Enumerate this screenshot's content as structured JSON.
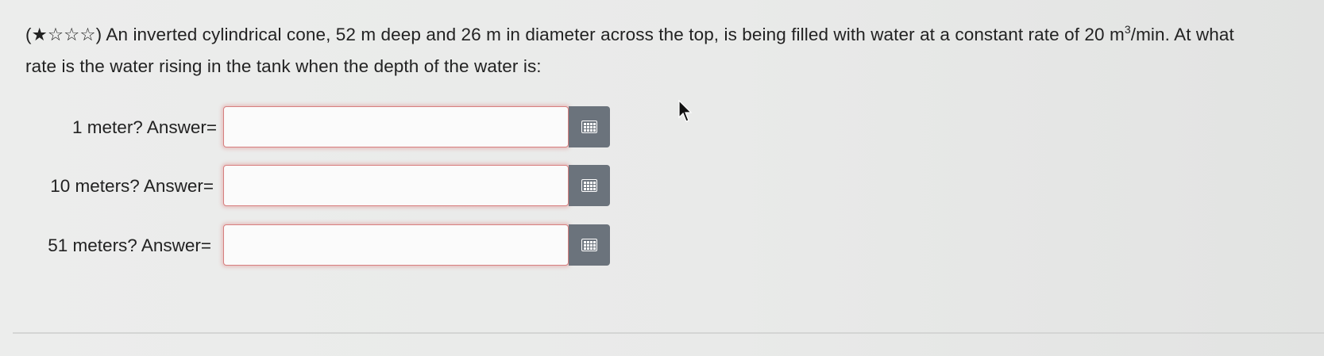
{
  "question": {
    "stars": "(★☆☆☆)",
    "text_before_unit": " An inverted cylindrical cone, 52 m deep and 26 m in diameter across the top, is being filled with water at a constant rate of 20 m",
    "unit_exponent": "3",
    "text_after_unit": "/min. At what rate is the water rising in the tank when the depth of the water is:"
  },
  "answers": [
    {
      "label": "1 meter? Answer=",
      "value": ""
    },
    {
      "label": "10 meters? Answer=",
      "value": ""
    },
    {
      "label": "51 meters? Answer=",
      "value": ""
    }
  ],
  "icons": {
    "keypad": "keypad-grid-icon",
    "cursor": "mouse-pointer-icon"
  },
  "colors": {
    "field_border": "#d77f7f",
    "keypad_button": "#6b737c"
  }
}
